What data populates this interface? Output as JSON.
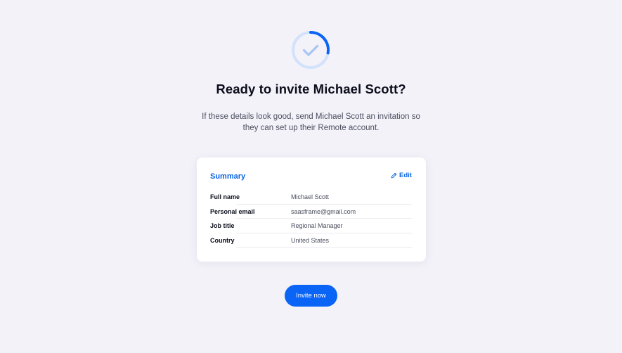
{
  "header": {
    "title": "Ready to invite Michael Scott?",
    "subtitle": "If these details look good, send Michael Scott an invitation so they can set up their Remote account.",
    "status_icon": "check-icon"
  },
  "summary": {
    "title": "Summary",
    "edit_label": "Edit",
    "edit_icon": "pencil-icon",
    "rows": [
      {
        "label": "Full name",
        "value": "Michael Scott"
      },
      {
        "label": "Personal email",
        "value": "saasframe@gmail.com"
      },
      {
        "label": "Job title",
        "value": "Regional Manager"
      },
      {
        "label": "Country",
        "value": "United States"
      }
    ]
  },
  "actions": {
    "invite_label": "Invite now"
  },
  "colors": {
    "background": "#f3f2f9",
    "accent": "#0a64f5",
    "ring_track": "#d3e2fb",
    "check": "#a9c6f2"
  }
}
